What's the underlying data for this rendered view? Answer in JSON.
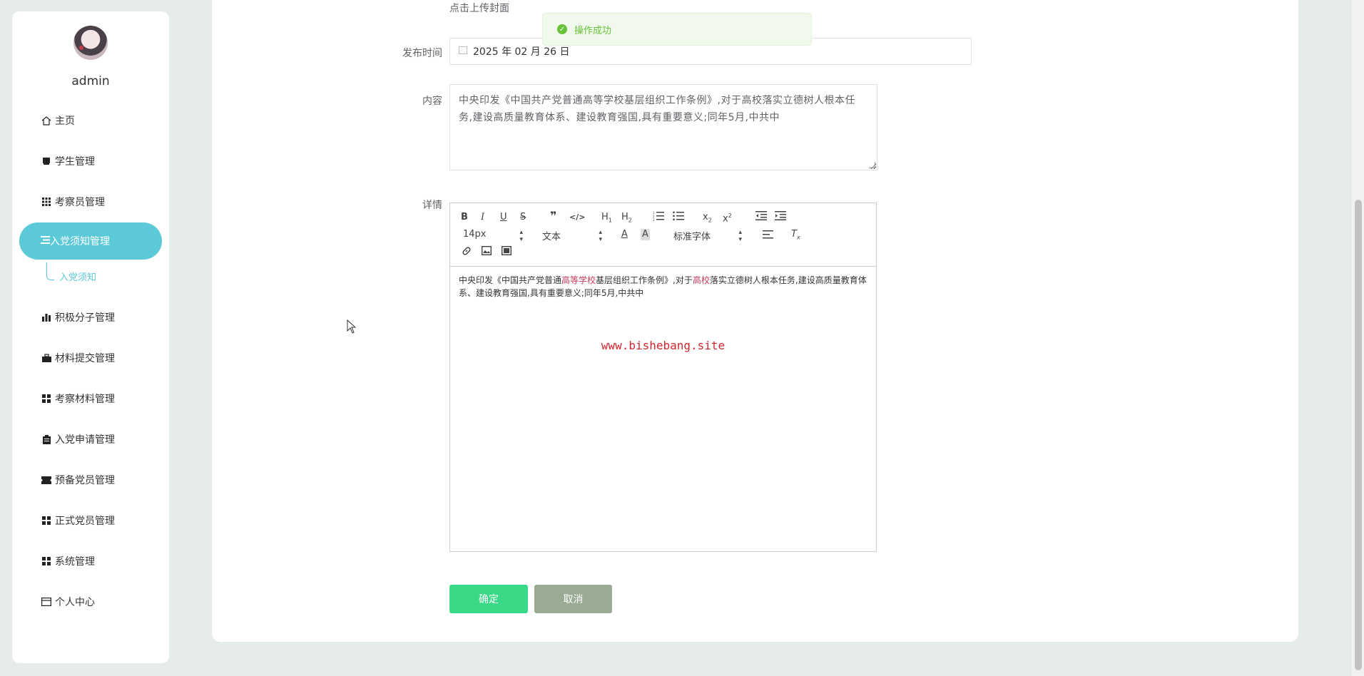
{
  "sidebar": {
    "username": "admin",
    "items": [
      {
        "label": "主页",
        "icon": "home-icon"
      },
      {
        "label": "学生管理",
        "icon": "book-icon"
      },
      {
        "label": "考察员管理",
        "icon": "grid-icon"
      },
      {
        "label": "入党须知管理",
        "icon": "list-icon",
        "active": true
      },
      {
        "label": "积极分子管理",
        "icon": "bar-chart-icon"
      },
      {
        "label": "材料提交管理",
        "icon": "briefcase-icon"
      },
      {
        "label": "考察材料管理",
        "icon": "apps-icon"
      },
      {
        "label": "入党申请管理",
        "icon": "clipboard-icon"
      },
      {
        "label": "预备党员管理",
        "icon": "ticket-icon"
      },
      {
        "label": "正式党员管理",
        "icon": "apps-icon"
      },
      {
        "label": "系统管理",
        "icon": "apps-icon"
      },
      {
        "label": "个人中心",
        "icon": "card-icon"
      }
    ],
    "sub_item": "入党须知"
  },
  "form": {
    "upload_hint": "点击上传封面",
    "date_label": "发布时间",
    "date_value": "2025 年 02 月 26 日",
    "content_label": "内容",
    "content_value": "中央印发《中国共产党普通高等学校基层组织工作条例》,对于高校落实立德树人根本任务,建设高质量教育体系、建设教育强国,具有重要意义;同年5月,中共中",
    "detail_label": "详情"
  },
  "editor": {
    "font_size": "14px",
    "block_type": "文本",
    "font_family": "标准字体",
    "body_part1": "中央印发《中国共产党普通",
    "body_red1": "高等学校",
    "body_part2": "基层组织工作条例》,对于",
    "body_red2": "高校",
    "body_part3": "落实立德树人根本任务,建设高质量教育体系、建设教育强国,具有重要意义;同年5月,中共中",
    "watermark": "www.bishebang.site"
  },
  "buttons": {
    "confirm": "确定",
    "cancel": "取消"
  },
  "toast": {
    "message": "操作成功"
  },
  "colors": {
    "accent": "#5cc9d8",
    "confirm": "#3ad987",
    "cancel": "#9aab93",
    "success": "#67c23a"
  }
}
